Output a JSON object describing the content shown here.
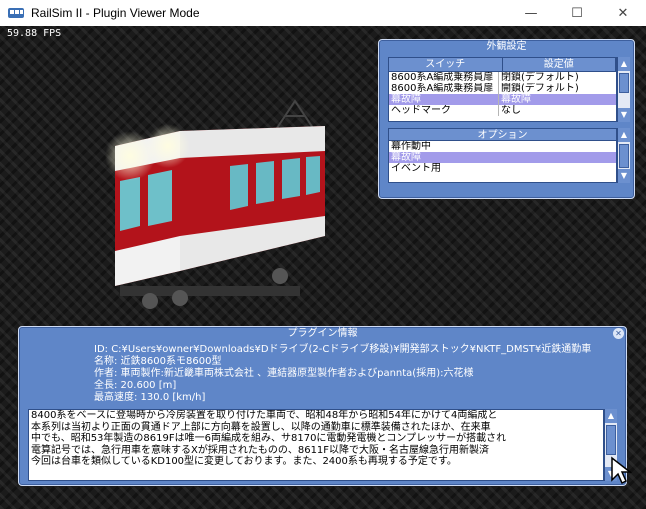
{
  "window": {
    "title": "RailSim II - Plugin Viewer Mode",
    "icon": "railsim-app-icon",
    "controls": {
      "minimize": "—",
      "maximize": "☐",
      "close": "✕"
    }
  },
  "viewport": {
    "fps": "59.88 FPS"
  },
  "appearance_panel": {
    "title": "外観設定",
    "columns": [
      "スイッチ",
      "設定値"
    ],
    "rows": [
      {
        "switch": "8600系A編成乗務員扉",
        "value": "閉鎖(デフォルト)",
        "selected": false
      },
      {
        "switch": "8600系A編成乗務員扉",
        "value": "開鎖(デフォルト)",
        "selected": false
      },
      {
        "switch": "幕故障",
        "value": "幕故障",
        "selected": true
      },
      {
        "switch": "ヘッドマーク",
        "value": "なし",
        "selected": false
      }
    ],
    "options_title": "オプション",
    "options": [
      {
        "label": "幕作動中",
        "selected": false
      },
      {
        "label": "幕故障",
        "selected": true
      },
      {
        "label": "イベント用",
        "selected": false
      }
    ]
  },
  "plugin_info": {
    "title": "プラグイン情報",
    "id": "ID: C:¥Users¥owner¥Downloads¥Dドライブ(2-Cドライブ移設)¥開発部ストック¥NKTF_DMST¥近鉄通勤車",
    "name": "名称: 近鉄8600系モ8600型",
    "author": "作者: 車両製作:新近畿車両株式会社 、連結器原型製作者およびpannta(採用):六花様",
    "length": "全長: 20.600 [m]",
    "max_speed": "最高速度: 130.0 [km/h]",
    "description": [
      "8400系をベースに登場時から冷房装置を取り付けた車両で、昭和48年から昭和54年にかけて4両編成と",
      "本系列は当初より正面の貫通ドア上部に方向幕を設置し、以降の通勤車に標準装備されたほか、在来車",
      "中でも、昭和53年製造の8619Fは唯一6両編成を組み、サ8170に電動発電機とコンプレッサーが搭載され",
      "電算記号では、急行用車を意味するXが採用されたものの、8611F以降で大阪・名古屋線急行用新製済",
      "今回は台車を類似しているKD100型に変更しております。また、2400系も再現する予定です。"
    ]
  },
  "colors": {
    "panel_blue": "#5f86c8",
    "selection": "#a29bea",
    "train_red": "#b3131b",
    "train_white": "#f2f2f2"
  }
}
